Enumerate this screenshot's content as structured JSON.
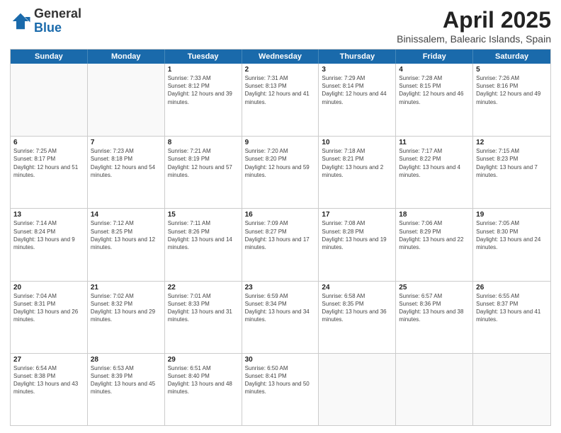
{
  "header": {
    "logo": {
      "general": "General",
      "blue": "Blue"
    },
    "title": "April 2025",
    "location": "Binissalem, Balearic Islands, Spain"
  },
  "weekdays": [
    "Sunday",
    "Monday",
    "Tuesday",
    "Wednesday",
    "Thursday",
    "Friday",
    "Saturday"
  ],
  "weeks": [
    [
      {
        "day": "",
        "sunrise": "",
        "sunset": "",
        "daylight": "",
        "empty": true
      },
      {
        "day": "",
        "sunrise": "",
        "sunset": "",
        "daylight": "",
        "empty": true
      },
      {
        "day": "1",
        "sunrise": "Sunrise: 7:33 AM",
        "sunset": "Sunset: 8:12 PM",
        "daylight": "Daylight: 12 hours and 39 minutes.",
        "empty": false
      },
      {
        "day": "2",
        "sunrise": "Sunrise: 7:31 AM",
        "sunset": "Sunset: 8:13 PM",
        "daylight": "Daylight: 12 hours and 41 minutes.",
        "empty": false
      },
      {
        "day": "3",
        "sunrise": "Sunrise: 7:29 AM",
        "sunset": "Sunset: 8:14 PM",
        "daylight": "Daylight: 12 hours and 44 minutes.",
        "empty": false
      },
      {
        "day": "4",
        "sunrise": "Sunrise: 7:28 AM",
        "sunset": "Sunset: 8:15 PM",
        "daylight": "Daylight: 12 hours and 46 minutes.",
        "empty": false
      },
      {
        "day": "5",
        "sunrise": "Sunrise: 7:26 AM",
        "sunset": "Sunset: 8:16 PM",
        "daylight": "Daylight: 12 hours and 49 minutes.",
        "empty": false
      }
    ],
    [
      {
        "day": "6",
        "sunrise": "Sunrise: 7:25 AM",
        "sunset": "Sunset: 8:17 PM",
        "daylight": "Daylight: 12 hours and 51 minutes.",
        "empty": false
      },
      {
        "day": "7",
        "sunrise": "Sunrise: 7:23 AM",
        "sunset": "Sunset: 8:18 PM",
        "daylight": "Daylight: 12 hours and 54 minutes.",
        "empty": false
      },
      {
        "day": "8",
        "sunrise": "Sunrise: 7:21 AM",
        "sunset": "Sunset: 8:19 PM",
        "daylight": "Daylight: 12 hours and 57 minutes.",
        "empty": false
      },
      {
        "day": "9",
        "sunrise": "Sunrise: 7:20 AM",
        "sunset": "Sunset: 8:20 PM",
        "daylight": "Daylight: 12 hours and 59 minutes.",
        "empty": false
      },
      {
        "day": "10",
        "sunrise": "Sunrise: 7:18 AM",
        "sunset": "Sunset: 8:21 PM",
        "daylight": "Daylight: 13 hours and 2 minutes.",
        "empty": false
      },
      {
        "day": "11",
        "sunrise": "Sunrise: 7:17 AM",
        "sunset": "Sunset: 8:22 PM",
        "daylight": "Daylight: 13 hours and 4 minutes.",
        "empty": false
      },
      {
        "day": "12",
        "sunrise": "Sunrise: 7:15 AM",
        "sunset": "Sunset: 8:23 PM",
        "daylight": "Daylight: 13 hours and 7 minutes.",
        "empty": false
      }
    ],
    [
      {
        "day": "13",
        "sunrise": "Sunrise: 7:14 AM",
        "sunset": "Sunset: 8:24 PM",
        "daylight": "Daylight: 13 hours and 9 minutes.",
        "empty": false
      },
      {
        "day": "14",
        "sunrise": "Sunrise: 7:12 AM",
        "sunset": "Sunset: 8:25 PM",
        "daylight": "Daylight: 13 hours and 12 minutes.",
        "empty": false
      },
      {
        "day": "15",
        "sunrise": "Sunrise: 7:11 AM",
        "sunset": "Sunset: 8:26 PM",
        "daylight": "Daylight: 13 hours and 14 minutes.",
        "empty": false
      },
      {
        "day": "16",
        "sunrise": "Sunrise: 7:09 AM",
        "sunset": "Sunset: 8:27 PM",
        "daylight": "Daylight: 13 hours and 17 minutes.",
        "empty": false
      },
      {
        "day": "17",
        "sunrise": "Sunrise: 7:08 AM",
        "sunset": "Sunset: 8:28 PM",
        "daylight": "Daylight: 13 hours and 19 minutes.",
        "empty": false
      },
      {
        "day": "18",
        "sunrise": "Sunrise: 7:06 AM",
        "sunset": "Sunset: 8:29 PM",
        "daylight": "Daylight: 13 hours and 22 minutes.",
        "empty": false
      },
      {
        "day": "19",
        "sunrise": "Sunrise: 7:05 AM",
        "sunset": "Sunset: 8:30 PM",
        "daylight": "Daylight: 13 hours and 24 minutes.",
        "empty": false
      }
    ],
    [
      {
        "day": "20",
        "sunrise": "Sunrise: 7:04 AM",
        "sunset": "Sunset: 8:31 PM",
        "daylight": "Daylight: 13 hours and 26 minutes.",
        "empty": false
      },
      {
        "day": "21",
        "sunrise": "Sunrise: 7:02 AM",
        "sunset": "Sunset: 8:32 PM",
        "daylight": "Daylight: 13 hours and 29 minutes.",
        "empty": false
      },
      {
        "day": "22",
        "sunrise": "Sunrise: 7:01 AM",
        "sunset": "Sunset: 8:33 PM",
        "daylight": "Daylight: 13 hours and 31 minutes.",
        "empty": false
      },
      {
        "day": "23",
        "sunrise": "Sunrise: 6:59 AM",
        "sunset": "Sunset: 8:34 PM",
        "daylight": "Daylight: 13 hours and 34 minutes.",
        "empty": false
      },
      {
        "day": "24",
        "sunrise": "Sunrise: 6:58 AM",
        "sunset": "Sunset: 8:35 PM",
        "daylight": "Daylight: 13 hours and 36 minutes.",
        "empty": false
      },
      {
        "day": "25",
        "sunrise": "Sunrise: 6:57 AM",
        "sunset": "Sunset: 8:36 PM",
        "daylight": "Daylight: 13 hours and 38 minutes.",
        "empty": false
      },
      {
        "day": "26",
        "sunrise": "Sunrise: 6:55 AM",
        "sunset": "Sunset: 8:37 PM",
        "daylight": "Daylight: 13 hours and 41 minutes.",
        "empty": false
      }
    ],
    [
      {
        "day": "27",
        "sunrise": "Sunrise: 6:54 AM",
        "sunset": "Sunset: 8:38 PM",
        "daylight": "Daylight: 13 hours and 43 minutes.",
        "empty": false
      },
      {
        "day": "28",
        "sunrise": "Sunrise: 6:53 AM",
        "sunset": "Sunset: 8:39 PM",
        "daylight": "Daylight: 13 hours and 45 minutes.",
        "empty": false
      },
      {
        "day": "29",
        "sunrise": "Sunrise: 6:51 AM",
        "sunset": "Sunset: 8:40 PM",
        "daylight": "Daylight: 13 hours and 48 minutes.",
        "empty": false
      },
      {
        "day": "30",
        "sunrise": "Sunrise: 6:50 AM",
        "sunset": "Sunset: 8:41 PM",
        "daylight": "Daylight: 13 hours and 50 minutes.",
        "empty": false
      },
      {
        "day": "",
        "sunrise": "",
        "sunset": "",
        "daylight": "",
        "empty": true
      },
      {
        "day": "",
        "sunrise": "",
        "sunset": "",
        "daylight": "",
        "empty": true
      },
      {
        "day": "",
        "sunrise": "",
        "sunset": "",
        "daylight": "",
        "empty": true
      }
    ]
  ]
}
